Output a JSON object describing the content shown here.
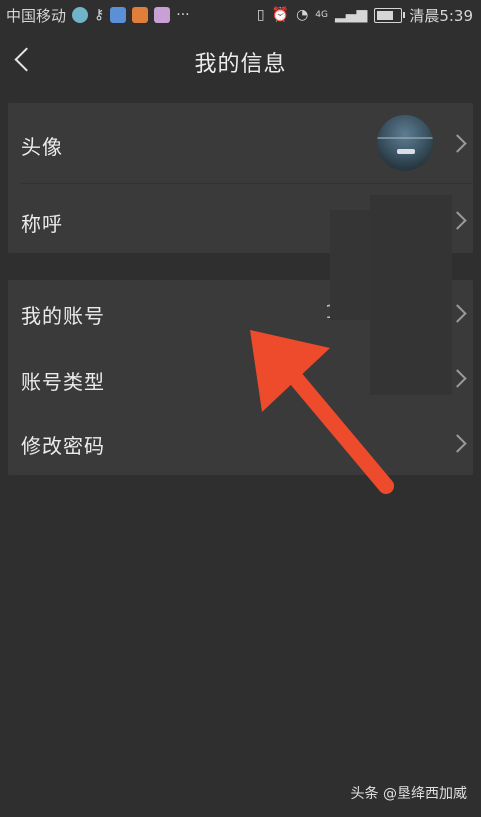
{
  "status_bar": {
    "carrier": "中国移动",
    "network": "4G",
    "time": "清晨5:39"
  },
  "header": {
    "title": "我的信息"
  },
  "profile": {
    "avatar_label": "头像",
    "nickname_label": "称呼"
  },
  "account": {
    "account_label": "我的账号",
    "account_value": "1",
    "account_type_label": "账号类型",
    "change_password_label": "修改密码"
  },
  "watermark": {
    "text": "头条 @垦绛西加威"
  },
  "colors": {
    "background": "#2f2f2f",
    "card": "#3a3a3a",
    "arrow": "#ee4a2c"
  }
}
